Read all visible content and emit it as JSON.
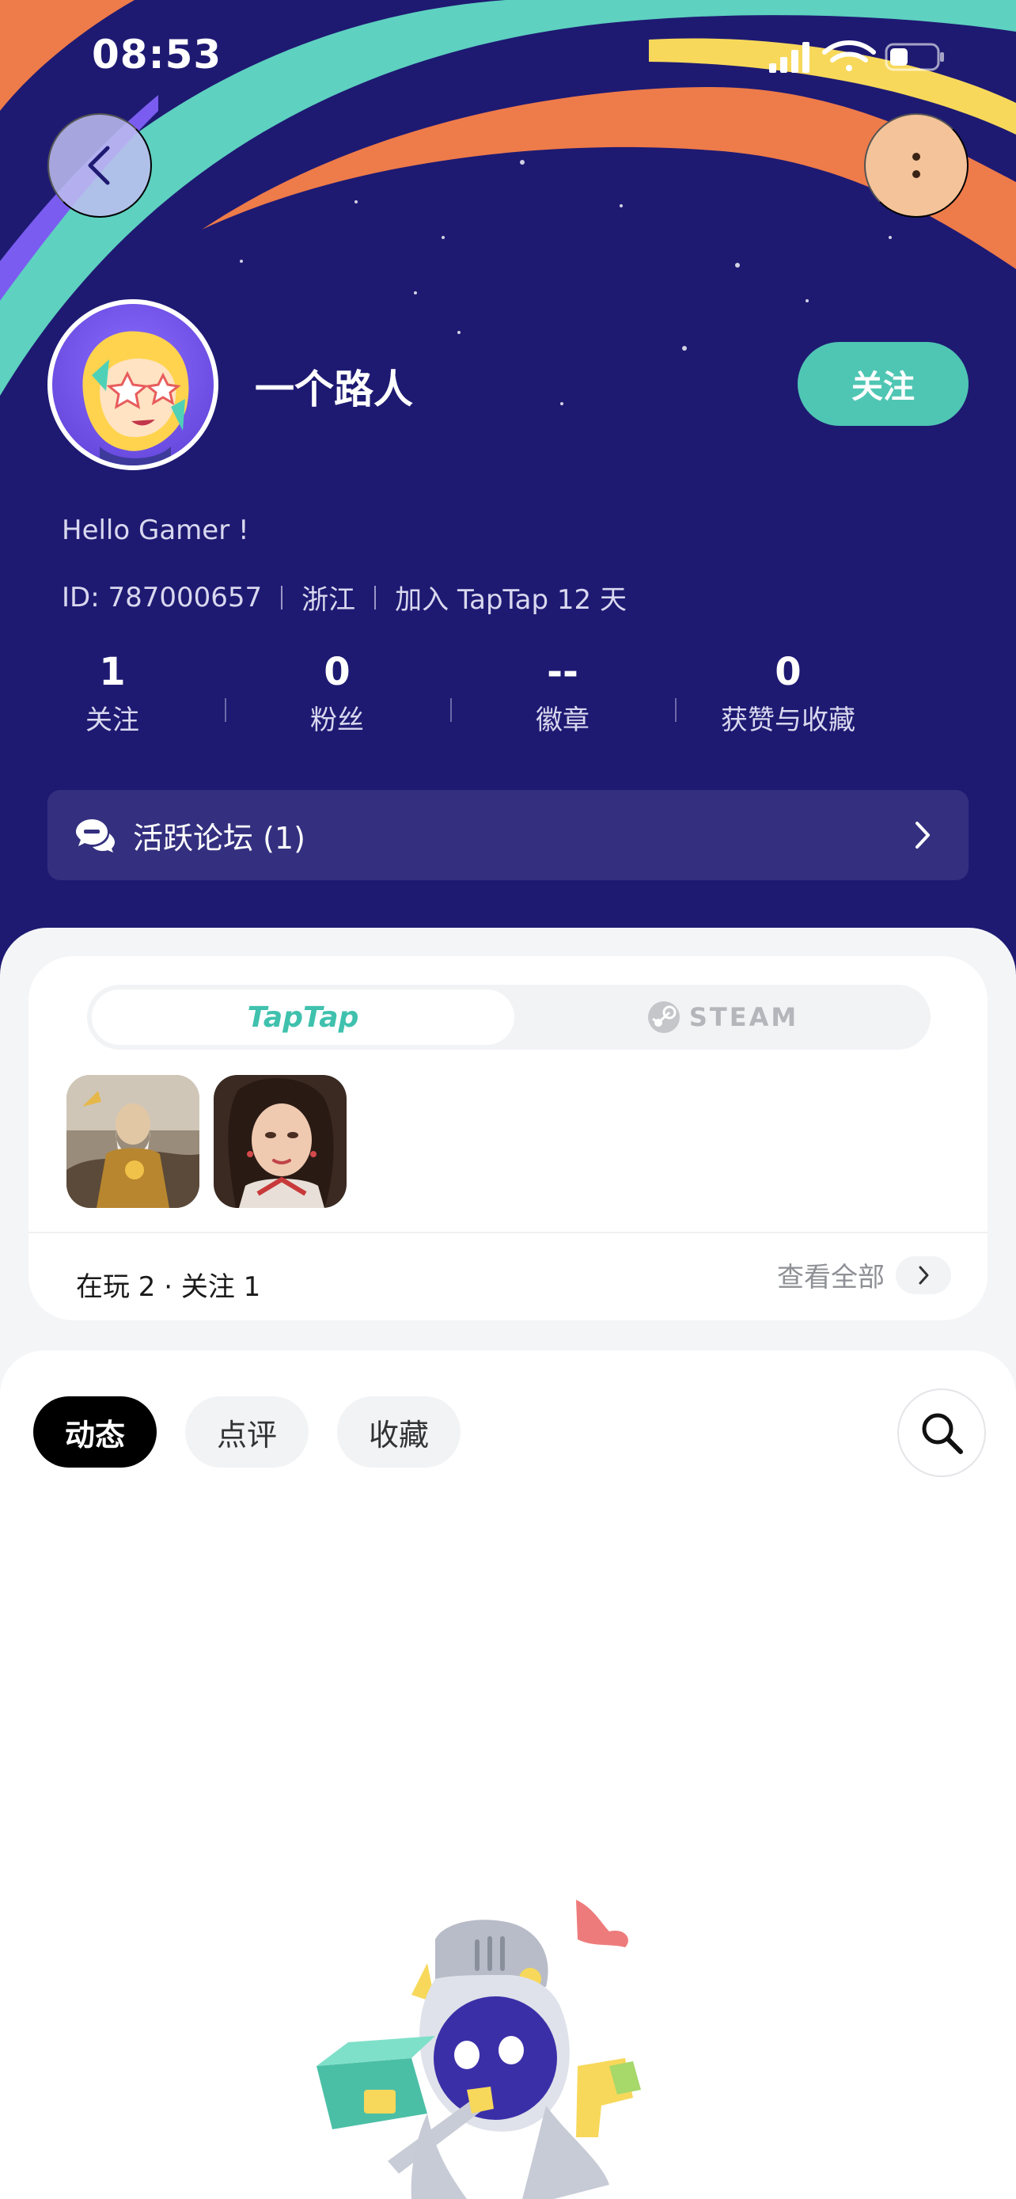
{
  "status_bar": {
    "time": "08:53"
  },
  "profile": {
    "username": "一个路人",
    "follow_label": "关注",
    "bio": "Hello Gamer !",
    "id_text": "ID: 787000657",
    "region": "浙江",
    "joined": "加入 TapTap 12 天"
  },
  "stats": [
    {
      "value": "1",
      "label": "关注"
    },
    {
      "value": "0",
      "label": "粉丝"
    },
    {
      "value": "--",
      "label": "徽章"
    },
    {
      "value": "0",
      "label": "获赞与收藏"
    }
  ],
  "forum": {
    "label": "活跃论坛 (1)"
  },
  "games": {
    "tabs": [
      {
        "label": "TapTap"
      },
      {
        "label": "STEAM"
      }
    ],
    "summary": "在玩 2 · 关注 1",
    "view_all": "查看全部"
  },
  "content_tabs": [
    {
      "label": "动态"
    },
    {
      "label": "点评"
    },
    {
      "label": "收藏"
    }
  ],
  "colors": {
    "hero_bg": "#1e1a72",
    "accent": "#4fc6b3",
    "stripe_orange": "#ee7b4a",
    "stripe_yellow": "#f7d85a"
  }
}
